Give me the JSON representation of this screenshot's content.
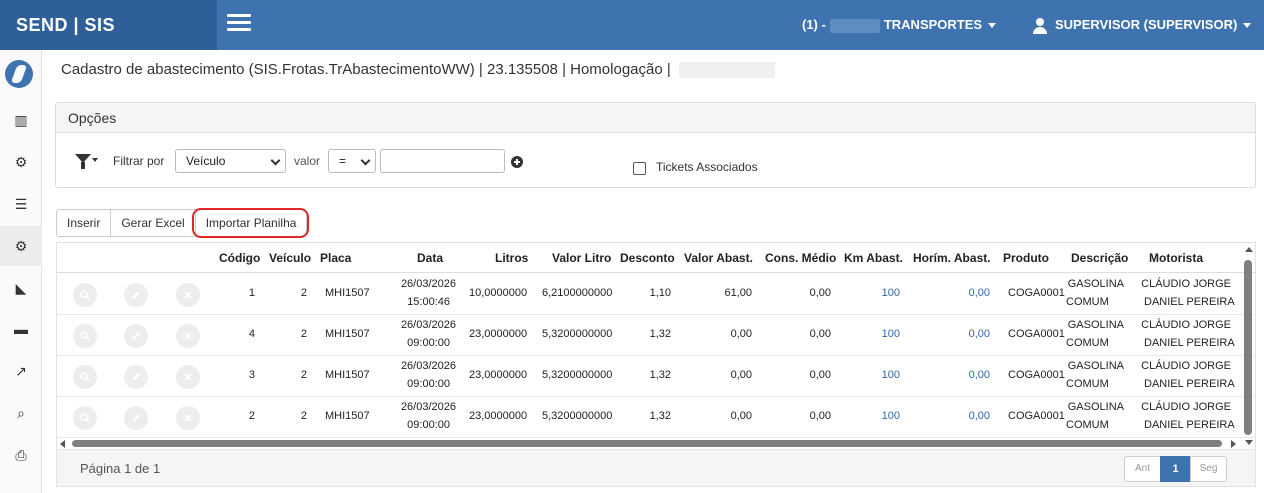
{
  "app": {
    "brand": "SEND | SIS"
  },
  "topbar": {
    "company_prefix": "(1) -",
    "company_name": "TRANSPORTES",
    "user": "SUPERVISOR (SUPERVISOR)"
  },
  "sidebar": {
    "items": [
      {
        "icon": "bar-chart-icon",
        "glyph": "▥"
      },
      {
        "icon": "gear-icon",
        "glyph": "⚙"
      },
      {
        "icon": "list-icon",
        "glyph": "☰"
      },
      {
        "icon": "gears-icon",
        "glyph": "⚙"
      },
      {
        "icon": "area-chart-icon",
        "glyph": "◣"
      },
      {
        "icon": "truck-icon",
        "glyph": "▬"
      },
      {
        "icon": "route-icon",
        "glyph": "↗"
      },
      {
        "icon": "search-icon",
        "glyph": "⌕"
      },
      {
        "icon": "print-icon",
        "glyph": "⎙"
      }
    ]
  },
  "page": {
    "title": "Cadastro de abastecimento (SIS.Frotas.TrAbastecimentoWW) | 23.135508 | Homologação |"
  },
  "options": {
    "heading": "Opções",
    "filter_by_label": "Filtrar por",
    "filter_field": "Veículo",
    "value_label": "valor",
    "operator": "=",
    "value": "",
    "tickets_label": "Tickets Associados",
    "tickets_checked": false
  },
  "toolbar": {
    "insert": "Inserir",
    "export_excel": "Gerar Excel",
    "import_sheet": "Importar Planilha"
  },
  "grid": {
    "columns": [
      "Código",
      "Veículo",
      "Placa",
      "Data",
      "Litros",
      "Valor Litro",
      "Desconto",
      "Valor Abast.",
      "Cons. Médio",
      "Km Abast.",
      "Horím. Abast.",
      "Produto",
      "Descrição",
      "Motorista"
    ],
    "rows": [
      {
        "codigo": "1",
        "veiculo": "2",
        "placa": "MHI1507",
        "data1": "26/03/2026",
        "data2": "15:00:46",
        "litros": "10,0000000",
        "valor_litro": "6,2100000000",
        "desconto": "1,10",
        "valor_abast": "61,00",
        "cons_medio": "0,00",
        "km_abast": "100",
        "horim_abast": "0,00",
        "produto": "COGA0001",
        "desc1": "GASOLINA",
        "desc2": "COMUM",
        "mot1": "CLÁUDIO JORGE",
        "mot2": "DANIEL PEREIRA"
      },
      {
        "codigo": "4",
        "veiculo": "2",
        "placa": "MHI1507",
        "data1": "26/03/2026",
        "data2": "09:00:00",
        "litros": "23,0000000",
        "valor_litro": "5,3200000000",
        "desconto": "1,32",
        "valor_abast": "0,00",
        "cons_medio": "0,00",
        "km_abast": "100",
        "horim_abast": "0,00",
        "produto": "COGA0001",
        "desc1": "GASOLINA",
        "desc2": "COMUM",
        "mot1": "CLÁUDIO JORGE",
        "mot2": "DANIEL PEREIRA"
      },
      {
        "codigo": "3",
        "veiculo": "2",
        "placa": "MHI1507",
        "data1": "26/03/2026",
        "data2": "09:00:00",
        "litros": "23,0000000",
        "valor_litro": "5,3200000000",
        "desconto": "1,32",
        "valor_abast": "0,00",
        "cons_medio": "0,00",
        "km_abast": "100",
        "horim_abast": "0,00",
        "produto": "COGA0001",
        "desc1": "GASOLINA",
        "desc2": "COMUM",
        "mot1": "CLÁUDIO JORGE",
        "mot2": "DANIEL PEREIRA"
      },
      {
        "codigo": "2",
        "veiculo": "2",
        "placa": "MHI1507",
        "data1": "26/03/2026",
        "data2": "09:00:00",
        "litros": "23,0000000",
        "valor_litro": "5,3200000000",
        "desconto": "1,32",
        "valor_abast": "0,00",
        "cons_medio": "0,00",
        "km_abast": "100",
        "horim_abast": "0,00",
        "produto": "COGA0001",
        "desc1": "GASOLINA",
        "desc2": "COMUM",
        "mot1": "CLÁUDIO JORGE",
        "mot2": "DANIEL PEREIRA"
      }
    ]
  },
  "footer": {
    "page_info": "Página 1 de 1",
    "prev": "Ant",
    "current": "1",
    "next": "Seg"
  },
  "colors": {
    "topbar": "#3f73b0",
    "brand_bg": "#2f5f99",
    "highlight": "#e0262b",
    "link": "#2f67a8"
  }
}
